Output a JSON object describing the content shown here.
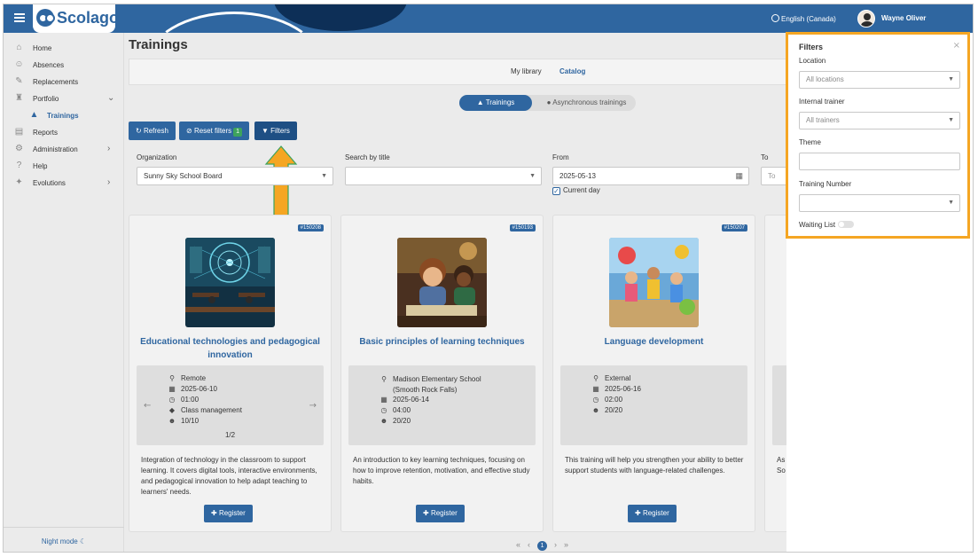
{
  "header": {
    "brand": "Scolago",
    "language": "English (Canada)",
    "user_name": "Wayne Oliver"
  },
  "sidebar": {
    "items": [
      {
        "label": "Home",
        "icon": "home-icon"
      },
      {
        "label": "Absences",
        "icon": "absences-icon"
      },
      {
        "label": "Replacements",
        "icon": "replacements-icon"
      },
      {
        "label": "Portfolio",
        "icon": "trophy-icon"
      },
      {
        "label": "Trainings",
        "icon": "graduation-cap-icon"
      },
      {
        "label": "Reports",
        "icon": "report-icon"
      },
      {
        "label": "Administration",
        "icon": "gear-icon"
      },
      {
        "label": "Help",
        "icon": "help-icon"
      },
      {
        "label": "Evolutions",
        "icon": "evolutions-icon"
      }
    ],
    "night_mode": "Night mode"
  },
  "main": {
    "title": "Trainings",
    "tabs": {
      "library": "My library",
      "catalog": "Catalog"
    },
    "toggle": {
      "trainings": "Trainings",
      "async": "Asynchronous trainings"
    },
    "buttons": {
      "refresh": "Refresh",
      "reset": "Reset filters",
      "reset_count": "1",
      "filters": "Filters"
    },
    "filters": {
      "organization_label": "Organization",
      "organization_value": "Sunny Sky School Board",
      "search_label": "Search by title",
      "from_label": "From",
      "from_value": "2025-05-13",
      "current_day": "Current day",
      "to_label": "To",
      "to_placeholder": "To"
    }
  },
  "cards": [
    {
      "number": "#150208",
      "title": "Educational technologies and pedagogical innovation",
      "location": "Remote",
      "date": "2025-06-10",
      "duration": "01:00",
      "category": "Class management",
      "seats": "10/10",
      "pager": "1/2",
      "description": "Integration of technology in the classroom to support learning. It covers digital tools, interactive environments, and pedagogical innovation to help adapt teaching to learners' needs.",
      "register": "Register"
    },
    {
      "number": "#150193",
      "title": "Basic principles of learning techniques",
      "location": "Madison Elementary School (Smooth Rock Falls)",
      "date": "2025-06-14",
      "duration": "04:00",
      "seats": "20/20",
      "description": "An introduction to key learning techniques, focusing on how to improve retention, motivation, and effective study habits.",
      "register": "Register"
    },
    {
      "number": "#150207",
      "title": "Language development",
      "location": "External",
      "date": "2025-06-16",
      "duration": "02:00",
      "seats": "20/20",
      "description": "This training will help you strengthen your ability to better support students with language-related challenges.",
      "register": "Register"
    }
  ],
  "partial_card": {
    "title": "I",
    "desc1": "As t",
    "desc2": "So v"
  },
  "pagination": {
    "current": "1"
  },
  "panel": {
    "title": "Filters",
    "location_label": "Location",
    "location_value": "All locations",
    "trainer_label": "Internal trainer",
    "trainer_value": "All trainers",
    "theme_label": "Theme",
    "number_label": "Training Number",
    "waiting_label": "Waiting List"
  },
  "colors": {
    "brand": "#2f66a0",
    "highlight": "#f5a623",
    "arrow": "#f5a623",
    "badge": "#3da35d"
  }
}
